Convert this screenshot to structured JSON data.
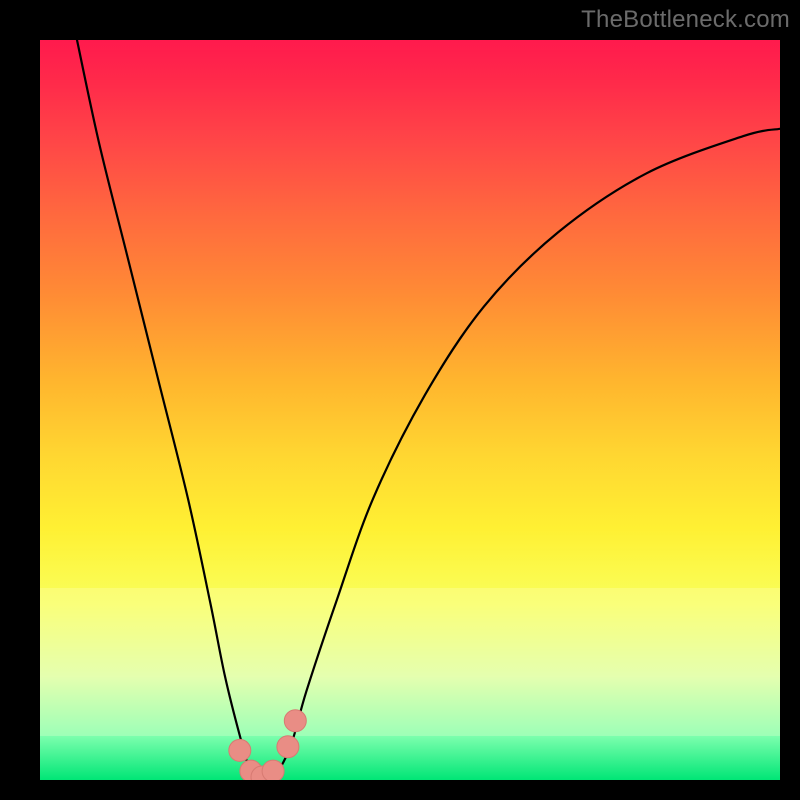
{
  "watermark": "TheBottleneck.com",
  "chart_data": {
    "type": "line",
    "title": "",
    "xlabel": "",
    "ylabel": "",
    "xlim": [
      0,
      100
    ],
    "ylim": [
      0,
      100
    ],
    "series": [
      {
        "name": "curve",
        "x": [
          5,
          8,
          12,
          16,
          20,
          23,
          25,
          27,
          28.5,
          30,
          32,
          34,
          36,
          40,
          45,
          52,
          60,
          70,
          82,
          95,
          100
        ],
        "y": [
          100,
          86,
          70,
          54,
          38,
          24,
          14,
          6,
          1,
          0,
          1,
          5,
          12,
          24,
          38,
          52,
          64,
          74,
          82,
          87,
          88
        ]
      }
    ],
    "markers": [
      {
        "x": 27.0,
        "y": 4.0
      },
      {
        "x": 28.5,
        "y": 1.2
      },
      {
        "x": 30.0,
        "y": 0.4
      },
      {
        "x": 31.5,
        "y": 1.2
      },
      {
        "x": 33.5,
        "y": 4.5
      },
      {
        "x": 34.5,
        "y": 8.0
      }
    ],
    "colors": {
      "curve": "#000000",
      "marker_fill": "#e98d85",
      "marker_stroke": "#d77a72"
    }
  }
}
